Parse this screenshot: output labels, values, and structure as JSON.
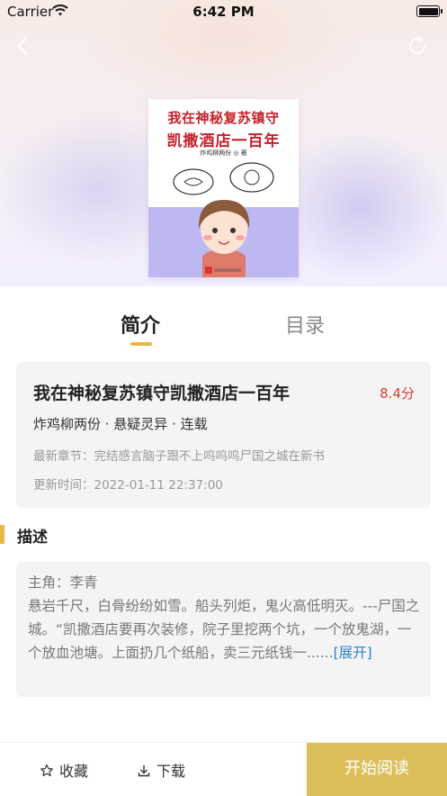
{
  "status_bar": {
    "carrier": "Carrier",
    "time": "6:42 PM"
  },
  "cover": {
    "title_line1": "我在神秘复苏镇守",
    "title_line2": "凯撒酒店一百年",
    "author": "炸鸡柳两份 ◎ 著"
  },
  "tabs": [
    {
      "label": "简介",
      "active": true
    },
    {
      "label": "目录",
      "active": false
    }
  ],
  "book": {
    "title": "我在神秘复苏镇守凯撒酒店一百年",
    "score": "8.4分",
    "meta": "炸鸡柳两份 · 悬疑灵异 · 连载",
    "latest_chapter": "最新章节：完结感言脑子跟不上呜呜呜尸国之城在新书",
    "updated": "更新时间：2022-01-11 22:37:00"
  },
  "description": {
    "section_title": "描述",
    "text": "主角：李青\n悬岩千尺，白骨纷纷如雪。船头列炬，鬼火高低明灭。---尸国之城。“凯撒酒店要再次装修，院子里挖两个坑，一个放鬼湖，一个放血池塘。上面扔几个纸船，卖三元纸钱一......",
    "expand_label": "[展开]"
  },
  "bottom_bar": {
    "favorite_label": "收藏",
    "download_label": "下载",
    "start_reading_label": "开始阅读"
  },
  "colors": {
    "accent": "#e4b948",
    "read_button": "#dcbe5a",
    "score": "#d2412f",
    "link": "#2e7fd6"
  }
}
